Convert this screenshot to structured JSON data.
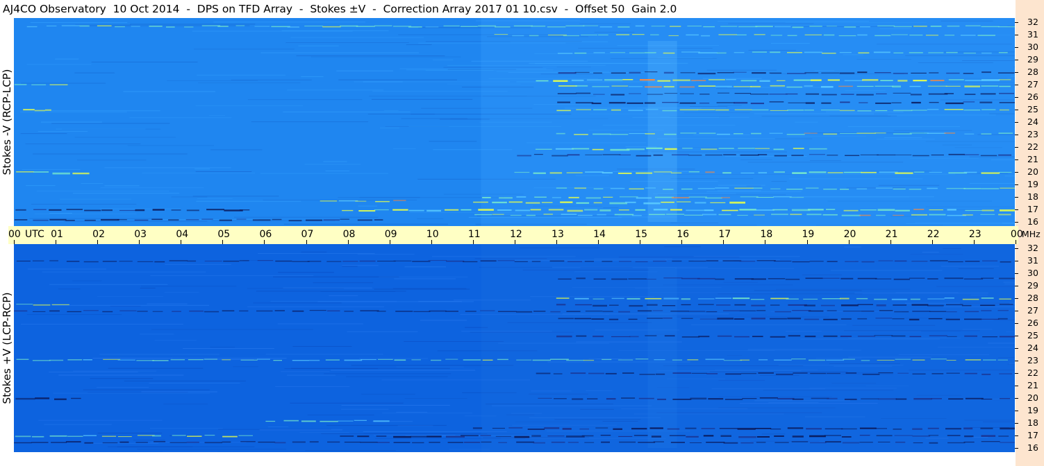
{
  "title": "AJ4CO Observatory  10 Oct 2014  -  DPS on TFD Array  -  Stokes ±V  -  Correction Array 2017 01 10.csv  -  Offset 50  Gain 2.0",
  "time_axis": {
    "labels": [
      "00",
      "01",
      "02",
      "03",
      "04",
      "05",
      "06",
      "07",
      "08",
      "09",
      "10",
      "11",
      "12",
      "13",
      "14",
      "15",
      "16",
      "17",
      "18",
      "19",
      "20",
      "21",
      "22",
      "23",
      "00"
    ],
    "utc_label": "UTC",
    "mhz_label": "MHz"
  },
  "freq_axis": {
    "labels": [
      "32",
      "31",
      "30",
      "29",
      "28",
      "27",
      "26",
      "25",
      "24",
      "23",
      "22",
      "21",
      "20",
      "19",
      "18",
      "17",
      "16"
    ]
  },
  "panels": {
    "top": {
      "label": "Stokes -V (RCP-LCP)"
    },
    "bottom": {
      "label": "Stokes +V (LCP-RCP)"
    }
  },
  "colors": {
    "top_background": "#1f86f0",
    "bottom_background": "#0d63df",
    "time_bar": "#ffffc4",
    "scrollbar": "#fde5cf",
    "bright_band": "#e6ff4a",
    "dark_band": "#0a1a5c"
  },
  "chart_data": [
    {
      "type": "heatmap",
      "title": "Stokes -V (RCP-LCP)",
      "xlabel": "UTC",
      "ylabel": "MHz",
      "xlim": [
        0,
        24
      ],
      "ylim": [
        16,
        32
      ],
      "bands": [
        {
          "freq": 31.7,
          "start": 0.3,
          "end": 24,
          "kind": "bright",
          "strength": 0.4
        },
        {
          "freq": 31.0,
          "start": 11.5,
          "end": 23.5,
          "kind": "bright",
          "strength": 0.35
        },
        {
          "freq": 29.6,
          "start": 13.0,
          "end": 24,
          "kind": "bright",
          "strength": 0.4
        },
        {
          "freq": 28.0,
          "start": 13.0,
          "end": 24,
          "kind": "dark",
          "strength": 0.7
        },
        {
          "freq": 27.4,
          "start": 12.5,
          "end": 24,
          "kind": "bright",
          "strength": 0.9
        },
        {
          "freq": 27.0,
          "start": 0.0,
          "end": 1.2,
          "kind": "bright",
          "strength": 0.7
        },
        {
          "freq": 26.9,
          "start": 13.0,
          "end": 24,
          "kind": "bright",
          "strength": 0.8
        },
        {
          "freq": 26.3,
          "start": 13.0,
          "end": 24,
          "kind": "dark",
          "strength": 0.6
        },
        {
          "freq": 25.6,
          "start": 13.0,
          "end": 24,
          "kind": "dark",
          "strength": 0.8
        },
        {
          "freq": 25.0,
          "start": 0.2,
          "end": 1.0,
          "kind": "bright",
          "strength": 0.6
        },
        {
          "freq": 25.0,
          "start": 13.0,
          "end": 24,
          "kind": "bright",
          "strength": 0.5
        },
        {
          "freq": 23.1,
          "start": 13.0,
          "end": 24,
          "kind": "bright",
          "strength": 0.4
        },
        {
          "freq": 21.9,
          "start": 12.5,
          "end": 16.0,
          "kind": "bright",
          "strength": 0.9
        },
        {
          "freq": 21.9,
          "start": 16.0,
          "end": 19.5,
          "kind": "bright",
          "strength": 0.6
        },
        {
          "freq": 21.4,
          "start": 12.0,
          "end": 24,
          "kind": "dark",
          "strength": 0.5
        },
        {
          "freq": 20.0,
          "start": 0.0,
          "end": 1.8,
          "kind": "bright",
          "strength": 0.9
        },
        {
          "freq": 20.0,
          "start": 12.0,
          "end": 24,
          "kind": "bright",
          "strength": 0.8
        },
        {
          "freq": 18.7,
          "start": 13.0,
          "end": 24,
          "kind": "bright",
          "strength": 0.35
        },
        {
          "freq": 18.0,
          "start": 11.2,
          "end": 19.0,
          "kind": "bright",
          "strength": 0.6
        },
        {
          "freq": 17.7,
          "start": 7.3,
          "end": 9.5,
          "kind": "bright",
          "strength": 0.9
        },
        {
          "freq": 17.6,
          "start": 11.0,
          "end": 17.5,
          "kind": "bright",
          "strength": 1.0
        },
        {
          "freq": 17.0,
          "start": 0.0,
          "end": 5.8,
          "kind": "dark",
          "strength": 0.8
        },
        {
          "freq": 17.0,
          "start": 7.8,
          "end": 24,
          "kind": "bright",
          "strength": 0.9
        },
        {
          "freq": 16.6,
          "start": 11.0,
          "end": 24,
          "kind": "bright",
          "strength": 0.5
        },
        {
          "freq": 16.2,
          "start": 0.0,
          "end": 9.0,
          "kind": "dark",
          "strength": 0.6
        }
      ]
    },
    {
      "type": "heatmap",
      "title": "Stokes +V (LCP-RCP)",
      "xlabel": "UTC",
      "ylabel": "MHz",
      "xlim": [
        0,
        24
      ],
      "ylim": [
        16,
        32
      ],
      "bands": [
        {
          "freq": 31.0,
          "start": 0.0,
          "end": 24,
          "kind": "dark",
          "strength": 0.35
        },
        {
          "freq": 29.6,
          "start": 13.0,
          "end": 24,
          "kind": "dark",
          "strength": 0.5
        },
        {
          "freq": 28.0,
          "start": 13.0,
          "end": 24,
          "kind": "bright",
          "strength": 0.6
        },
        {
          "freq": 27.5,
          "start": 0.0,
          "end": 1.3,
          "kind": "bright",
          "strength": 0.5
        },
        {
          "freq": 27.5,
          "start": 13.0,
          "end": 24,
          "kind": "dark",
          "strength": 0.8
        },
        {
          "freq": 27.0,
          "start": 0.0,
          "end": 24,
          "kind": "dark",
          "strength": 0.4
        },
        {
          "freq": 26.4,
          "start": 13.0,
          "end": 24,
          "kind": "dark",
          "strength": 0.7
        },
        {
          "freq": 25.0,
          "start": 13.0,
          "end": 24,
          "kind": "dark",
          "strength": 0.8
        },
        {
          "freq": 23.1,
          "start": 0.0,
          "end": 24,
          "kind": "bright",
          "strength": 0.35
        },
        {
          "freq": 22.0,
          "start": 12.5,
          "end": 24,
          "kind": "dark",
          "strength": 0.5
        },
        {
          "freq": 20.0,
          "start": 0.0,
          "end": 1.8,
          "kind": "dark",
          "strength": 0.9
        },
        {
          "freq": 20.0,
          "start": 12.5,
          "end": 24,
          "kind": "dark",
          "strength": 0.8
        },
        {
          "freq": 18.2,
          "start": 6.0,
          "end": 9.0,
          "kind": "bright",
          "strength": 0.5
        },
        {
          "freq": 17.6,
          "start": 11.0,
          "end": 24,
          "kind": "dark",
          "strength": 0.9
        },
        {
          "freq": 17.0,
          "start": 0.0,
          "end": 5.8,
          "kind": "bright",
          "strength": 0.6
        },
        {
          "freq": 17.0,
          "start": 7.8,
          "end": 24,
          "kind": "dark",
          "strength": 0.9
        },
        {
          "freq": 16.5,
          "start": 0.0,
          "end": 24,
          "kind": "dark",
          "strength": 0.5
        }
      ]
    }
  ]
}
